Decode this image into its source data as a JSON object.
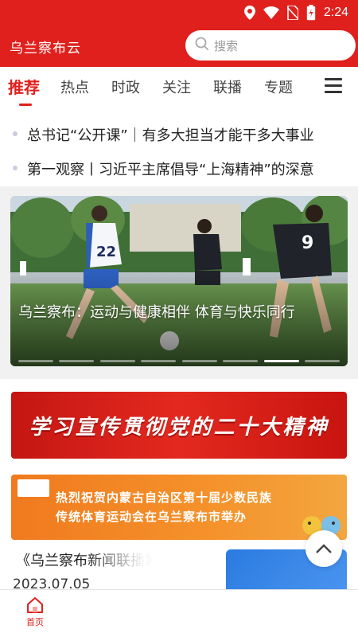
{
  "status_bar": {
    "time": "2:24"
  },
  "header": {
    "title": "乌兰察布云",
    "search_placeholder": "搜索"
  },
  "tabs": [
    {
      "label": "推荐",
      "active": true
    },
    {
      "label": "热点"
    },
    {
      "label": "时政"
    },
    {
      "label": "关注"
    },
    {
      "label": "联播"
    },
    {
      "label": "专题"
    }
  ],
  "headlines": [
    "总书记“公开课”｜有多大担当才能干多大事业",
    "第一观察丨习近平主席倡导“上海精神”的深意"
  ],
  "hero": {
    "caption": "乌兰察布：运动与健康相伴 体育与快乐同行",
    "jersey_1": "22",
    "jersey_2": "9",
    "slides_total": 8,
    "slide_active": 6
  },
  "banners": [
    {
      "text": "学习宣传贯彻党的二十大精神"
    },
    {
      "line1": "热烈祝贺内蒙古自治区第十届少数民族",
      "line2": "传统体育运动会在乌兰察布市举办"
    }
  ],
  "news_item": {
    "title": "《乌兰察布新闻联播》",
    "date": "2023.07.05"
  },
  "bottom_nav": {
    "home_label": "首页"
  },
  "colors": {
    "brand": "#e0201c",
    "banner_orange": "#f5922b"
  }
}
